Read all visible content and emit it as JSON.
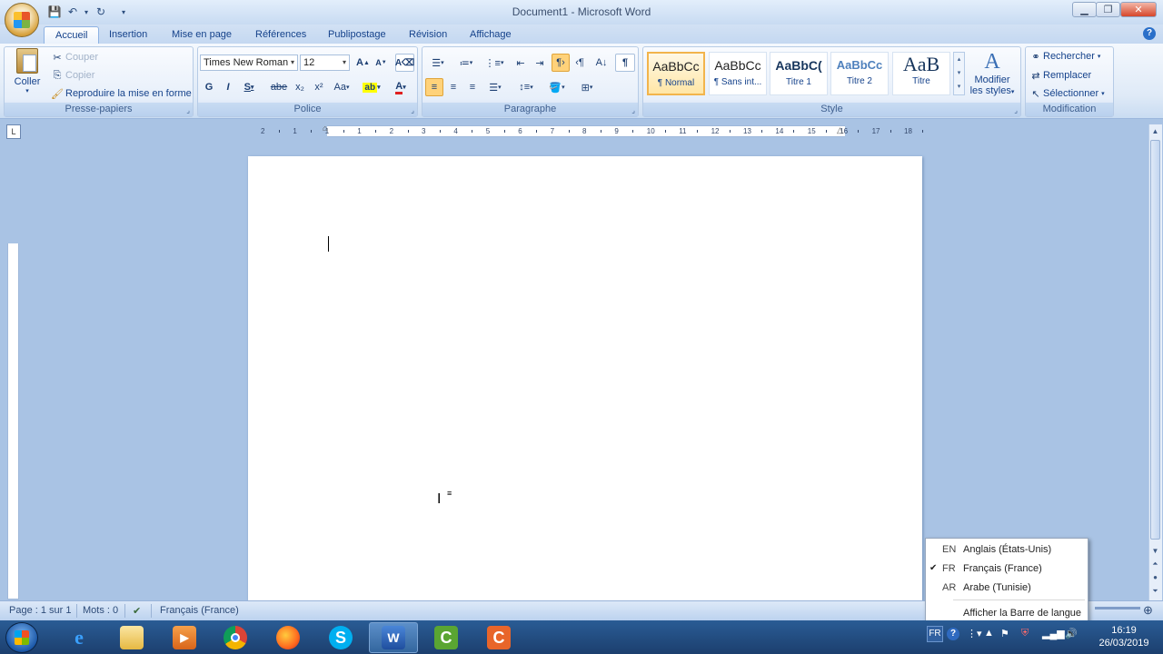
{
  "window": {
    "title": "Document1 - Microsoft Word"
  },
  "tabs": [
    {
      "label": "Accueil"
    },
    {
      "label": "Insertion"
    },
    {
      "label": "Mise en page"
    },
    {
      "label": "Références"
    },
    {
      "label": "Publipostage"
    },
    {
      "label": "Révision"
    },
    {
      "label": "Affichage"
    }
  ],
  "ribbon": {
    "clipboard": {
      "group_label": "Presse-papiers",
      "paste_label": "Coller",
      "cut_label": "Couper",
      "copy_label": "Copier",
      "format_painter_label": "Reproduire la mise en forme"
    },
    "font": {
      "group_label": "Police",
      "font_name": "Times New Roman",
      "font_size": "12",
      "bold": "G",
      "italic": "I",
      "underline": "S",
      "strike": "abe",
      "subscript": "x₂",
      "superscript": "x²",
      "case": "Aa",
      "grow": "A",
      "shrink": "A"
    },
    "paragraph": {
      "group_label": "Paragraphe"
    },
    "styles": {
      "group_label": "Style",
      "items": [
        {
          "preview": "AaBbCc",
          "name": "¶ Normal"
        },
        {
          "preview": "AaBbCc",
          "name": "¶ Sans int..."
        },
        {
          "preview": "AaBbC(",
          "name": "Titre 1"
        },
        {
          "preview": "AaBbCc",
          "name": "Titre 2"
        },
        {
          "preview": "AaB",
          "name": "Titre"
        }
      ],
      "change_styles_label_1": "Modifier",
      "change_styles_label_2": "les styles"
    },
    "editing": {
      "group_label": "Modification",
      "find_label": "Rechercher",
      "replace_label": "Remplacer",
      "select_label": "Sélectionner"
    }
  },
  "ruler": {
    "marks": [
      "2",
      "1",
      "1",
      "1",
      "2",
      "3",
      "4",
      "5",
      "6",
      "7",
      "8",
      "9",
      "10",
      "11",
      "12",
      "13",
      "14",
      "15",
      "16",
      "17",
      "18"
    ]
  },
  "statusbar": {
    "page": "Page : 1 sur 1",
    "words": "Mots : 0",
    "language": "Français (France)"
  },
  "language_menu": {
    "items": [
      {
        "code": "EN",
        "name": "Anglais (États-Unis)",
        "checked": false
      },
      {
        "code": "FR",
        "name": "Français (France)",
        "checked": true
      },
      {
        "code": "AR",
        "name": "Arabe (Tunisie)",
        "checked": false
      }
    ],
    "show_bar_label": "Afficher la Barre de langue"
  },
  "taskbar": {
    "lang_indicator": "FR",
    "time": "16:19",
    "date": "26/03/2019"
  }
}
